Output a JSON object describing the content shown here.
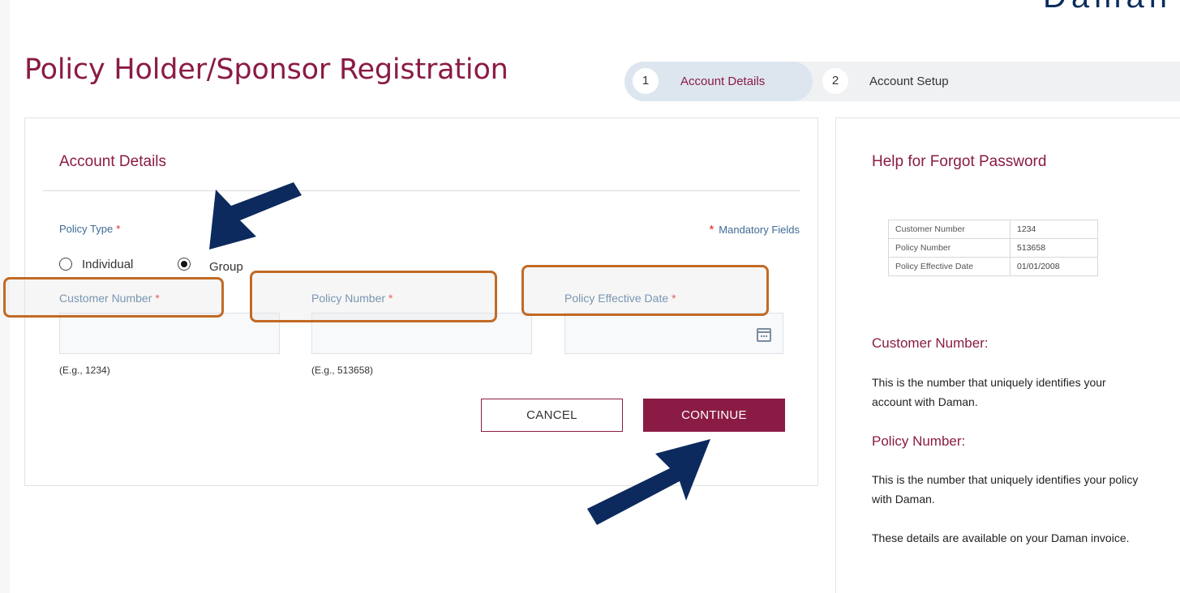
{
  "header": {
    "page_title": "Policy Holder/Sponsor Registration"
  },
  "stepper": {
    "steps": [
      {
        "number": "1",
        "label": "Account Details",
        "active": true
      },
      {
        "number": "2",
        "label": "Account Setup",
        "active": false
      }
    ]
  },
  "form": {
    "title": "Account Details",
    "policy_type_label": "Policy Type",
    "required_mark": "*",
    "mandatory_note": "Mandatory Fields",
    "policy_type_options": [
      {
        "label": "Individual",
        "selected": false
      },
      {
        "label": "Group",
        "selected": true
      }
    ],
    "fields": [
      {
        "label": "Customer Number",
        "value": "",
        "hint": "(E.g., 1234)"
      },
      {
        "label": "Policy Number",
        "value": "",
        "hint": "(E.g., 513658)"
      },
      {
        "label": "Policy Effective Date",
        "value": "",
        "hint": ""
      }
    ],
    "cancel_label": "CANCEL",
    "continue_label": "CONTINUE"
  },
  "help": {
    "title": "Help for Forgot Password",
    "sample_table": [
      {
        "key": "Customer Number",
        "value": "1234"
      },
      {
        "key": "Policy Number",
        "value": "513658"
      },
      {
        "key": "Policy Effective Date",
        "value": "01/01/2008"
      }
    ],
    "customer_number_heading": "Customer Number:",
    "customer_number_text": "This is the number that uniquely identifies your account with Daman.",
    "policy_number_heading": "Policy Number:",
    "policy_number_text": "This is the number that uniquely identifies your policy with Daman.",
    "invoice_note": "These details are available on your Daman invoice."
  },
  "colors": {
    "brand": "#8a1b45",
    "label": "#3f6b96",
    "highlight": "#c26a24",
    "annotation_arrow": "#0d2a5e"
  },
  "icons": {
    "calendar": "calendar-icon"
  }
}
